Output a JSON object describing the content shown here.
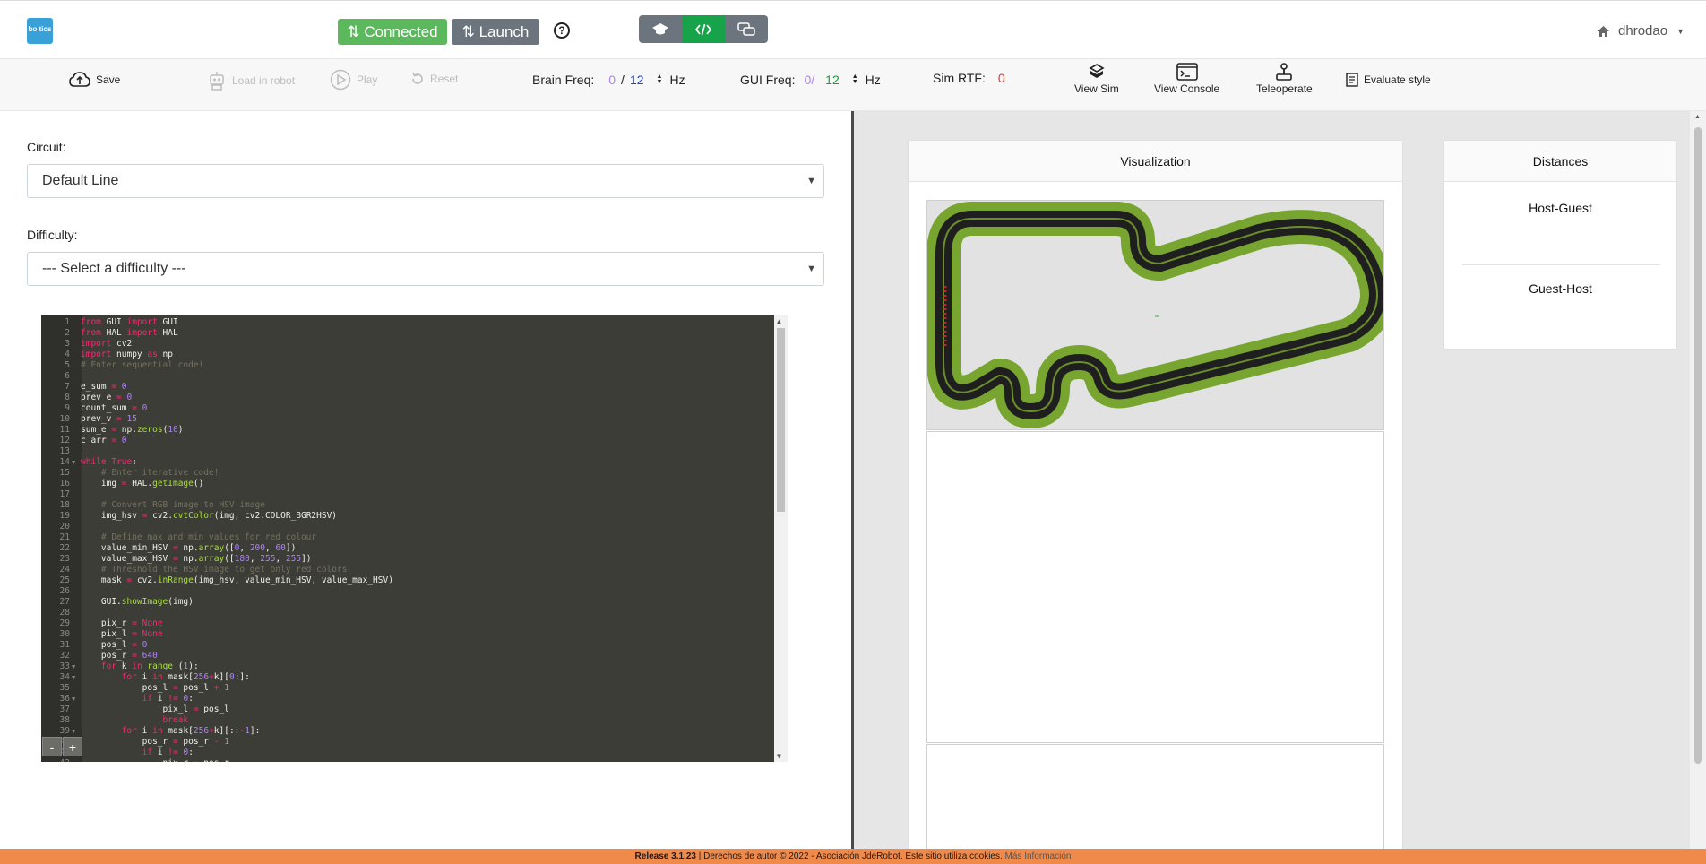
{
  "navbar": {
    "logo_text": "bo tics",
    "connected_label": "Connected",
    "launch_label": "Launch",
    "user_name": "dhrodao"
  },
  "toolbar": {
    "save_label": "Save",
    "load_label": "Load in robot",
    "play_label": "Play",
    "reset_label": "Reset",
    "brain_freq_label": "Brain Freq:",
    "brain_freq_value": "0",
    "brain_freq_sep": "/",
    "brain_freq_target": "12",
    "brain_freq_unit": "Hz",
    "gui_freq_label": "GUI Freq:",
    "gui_freq_value": "0/",
    "gui_freq_target": "12",
    "gui_freq_unit": "Hz",
    "sim_rtf_label": "Sim RTF:",
    "sim_rtf_value": "0",
    "view_sim_label": "View Sim",
    "view_console_label": "View Console",
    "teleoperate_label": "Teleoperate",
    "evaluate_label": "Evaluate style"
  },
  "form": {
    "circuit_label": "Circuit:",
    "circuit_value": "Default Line",
    "difficulty_label": "Difficulty:",
    "difficulty_value": "--- Select a difficulty ---"
  },
  "editor": {
    "zoom_out": "-",
    "zoom_in": "+",
    "lines": [
      "from GUI import GUI",
      "from HAL import HAL",
      "import cv2",
      "import numpy as np",
      "# Enter sequential code!",
      "",
      "e_sum = 0",
      "prev_e = 0",
      "count_sum = 0",
      "prev_v = 15",
      "sum_e = np.zeros(10)",
      "c_arr = 0",
      "",
      "while True:",
      "    # Enter iterative code!",
      "    img = HAL.getImage()",
      "",
      "    # Convert RGB image to HSV image",
      "    img_hsv = cv2.cvtColor(img, cv2.COLOR_BGR2HSV)",
      "",
      "    # Define max and min values for red colour",
      "    value_min_HSV = np.array([0, 200, 60])",
      "    value_max_HSV = np.array([180, 255, 255])",
      "    # Threshold the HSV image to get only red colors",
      "    mask = cv2.inRange(img_hsv, value_min_HSV, value_max_HSV)",
      "",
      "    GUI.showImage(img)",
      "",
      "    pix_r = None",
      "    pix_l = None",
      "    pos_l = 0",
      "    pos_r = 640",
      "    for k in range (1):",
      "        for i in mask[256+k][0:]:",
      "            pos_l = pos_l + 1",
      "            if i != 0:",
      "                pix_l = pos_l",
      "                break",
      "        for i in mask[256+k][::-1]:",
      "            pos_r = pos_r - 1",
      "            if i != 0:",
      "                pix_r = pos_r"
    ]
  },
  "visualization": {
    "title": "Visualization"
  },
  "distances": {
    "title": "Distances",
    "host_guest": "Host-Guest",
    "guest_host": "Guest-Host"
  },
  "footer": {
    "release": "Release 3.1.23",
    "copyright": " | Derechos de autor © 2022 - Asociación JdeRobot. Este sitio utiliza cookies. ",
    "more": "Más Información"
  },
  "colors": {
    "connected": "#5cb85c",
    "launch": "#6c757d",
    "active_mode": "#17a34a",
    "footer": "#f08a4b",
    "editor_bg": "#3c3d36",
    "track_green": "#77a52f"
  }
}
